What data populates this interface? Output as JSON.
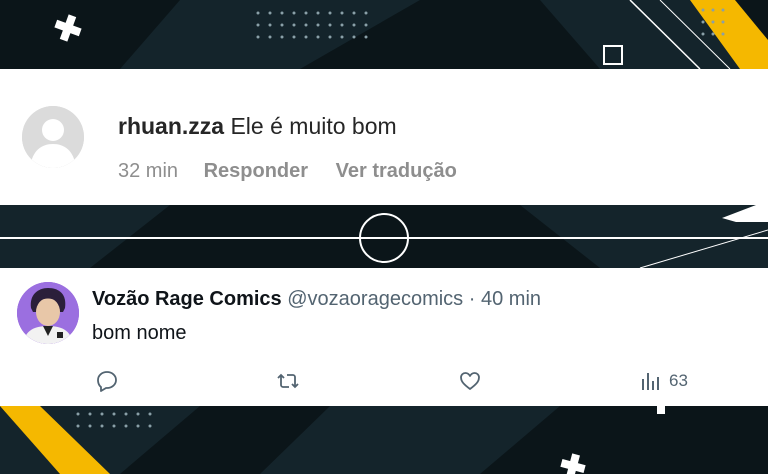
{
  "instagram_comment": {
    "username": "rhuan.zza",
    "text": "Ele é muito bom",
    "time": "32 min",
    "reply_label": "Responder",
    "translate_label": "Ver tradução"
  },
  "tweet": {
    "display_name": "Vozão Rage Comics",
    "handle": "@vozaoragecomics",
    "separator": "·",
    "time": "40 min",
    "text": "bom nome",
    "actions": {
      "reply_icon": "reply-icon",
      "retweet_icon": "retweet-icon",
      "like_icon": "like-icon",
      "views_icon": "views-icon",
      "views_count": "63"
    }
  },
  "colors": {
    "background": "#0b1519",
    "accent_yellow": "#f5b800",
    "tweet_gray": "#536471",
    "ig_gray": "#8e8e8e"
  }
}
